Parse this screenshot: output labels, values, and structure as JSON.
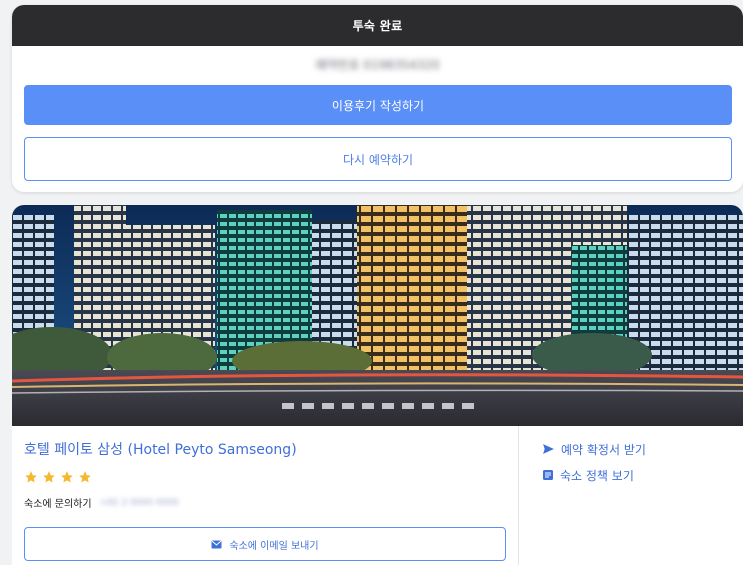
{
  "booking": {
    "status_title": "투숙 완료",
    "blurred_detail": "예약번호 0198354320",
    "review_button": "이용후기 작성하기",
    "rebook_button": "다시 예약하기"
  },
  "hotel": {
    "name": "호텔 페이토 삼성 (Hotel Peyto Samseong)",
    "star_rating": 4,
    "inquiry_label": "숙소에 문의하기",
    "inquiry_value": "+82 2 0000 0000",
    "email_button": "숙소에 이메일 보내기",
    "side_actions": [
      {
        "label": "예약 확정서 받기",
        "icon": "send-arrow-icon"
      },
      {
        "label": "숙소 정책 보기",
        "icon": "policy-document-icon"
      }
    ]
  },
  "colors": {
    "status_bar": "#2c2c2e",
    "accent": "#5b8ff8",
    "link": "#3f6fd8",
    "star": "#f5b82e"
  }
}
